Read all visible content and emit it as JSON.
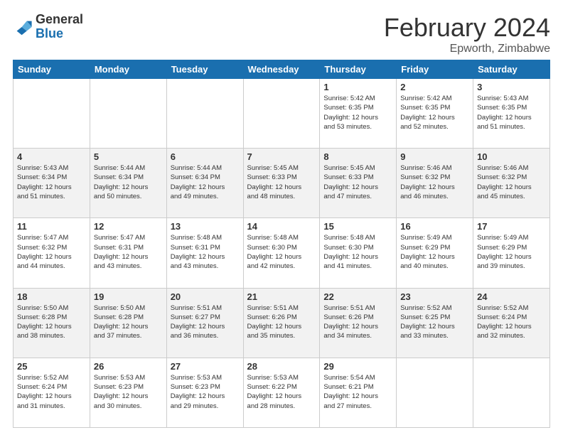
{
  "header": {
    "logo_general": "General",
    "logo_blue": "Blue",
    "title": "February 2024",
    "subtitle": "Epworth, Zimbabwe"
  },
  "weekdays": [
    "Sunday",
    "Monday",
    "Tuesday",
    "Wednesday",
    "Thursday",
    "Friday",
    "Saturday"
  ],
  "weeks": [
    [
      {
        "day": "",
        "info": ""
      },
      {
        "day": "",
        "info": ""
      },
      {
        "day": "",
        "info": ""
      },
      {
        "day": "",
        "info": ""
      },
      {
        "day": "1",
        "info": "Sunrise: 5:42 AM\nSunset: 6:35 PM\nDaylight: 12 hours\nand 53 minutes."
      },
      {
        "day": "2",
        "info": "Sunrise: 5:42 AM\nSunset: 6:35 PM\nDaylight: 12 hours\nand 52 minutes."
      },
      {
        "day": "3",
        "info": "Sunrise: 5:43 AM\nSunset: 6:35 PM\nDaylight: 12 hours\nand 51 minutes."
      }
    ],
    [
      {
        "day": "4",
        "info": "Sunrise: 5:43 AM\nSunset: 6:34 PM\nDaylight: 12 hours\nand 51 minutes."
      },
      {
        "day": "5",
        "info": "Sunrise: 5:44 AM\nSunset: 6:34 PM\nDaylight: 12 hours\nand 50 minutes."
      },
      {
        "day": "6",
        "info": "Sunrise: 5:44 AM\nSunset: 6:34 PM\nDaylight: 12 hours\nand 49 minutes."
      },
      {
        "day": "7",
        "info": "Sunrise: 5:45 AM\nSunset: 6:33 PM\nDaylight: 12 hours\nand 48 minutes."
      },
      {
        "day": "8",
        "info": "Sunrise: 5:45 AM\nSunset: 6:33 PM\nDaylight: 12 hours\nand 47 minutes."
      },
      {
        "day": "9",
        "info": "Sunrise: 5:46 AM\nSunset: 6:32 PM\nDaylight: 12 hours\nand 46 minutes."
      },
      {
        "day": "10",
        "info": "Sunrise: 5:46 AM\nSunset: 6:32 PM\nDaylight: 12 hours\nand 45 minutes."
      }
    ],
    [
      {
        "day": "11",
        "info": "Sunrise: 5:47 AM\nSunset: 6:32 PM\nDaylight: 12 hours\nand 44 minutes."
      },
      {
        "day": "12",
        "info": "Sunrise: 5:47 AM\nSunset: 6:31 PM\nDaylight: 12 hours\nand 43 minutes."
      },
      {
        "day": "13",
        "info": "Sunrise: 5:48 AM\nSunset: 6:31 PM\nDaylight: 12 hours\nand 43 minutes."
      },
      {
        "day": "14",
        "info": "Sunrise: 5:48 AM\nSunset: 6:30 PM\nDaylight: 12 hours\nand 42 minutes."
      },
      {
        "day": "15",
        "info": "Sunrise: 5:48 AM\nSunset: 6:30 PM\nDaylight: 12 hours\nand 41 minutes."
      },
      {
        "day": "16",
        "info": "Sunrise: 5:49 AM\nSunset: 6:29 PM\nDaylight: 12 hours\nand 40 minutes."
      },
      {
        "day": "17",
        "info": "Sunrise: 5:49 AM\nSunset: 6:29 PM\nDaylight: 12 hours\nand 39 minutes."
      }
    ],
    [
      {
        "day": "18",
        "info": "Sunrise: 5:50 AM\nSunset: 6:28 PM\nDaylight: 12 hours\nand 38 minutes."
      },
      {
        "day": "19",
        "info": "Sunrise: 5:50 AM\nSunset: 6:28 PM\nDaylight: 12 hours\nand 37 minutes."
      },
      {
        "day": "20",
        "info": "Sunrise: 5:51 AM\nSunset: 6:27 PM\nDaylight: 12 hours\nand 36 minutes."
      },
      {
        "day": "21",
        "info": "Sunrise: 5:51 AM\nSunset: 6:26 PM\nDaylight: 12 hours\nand 35 minutes."
      },
      {
        "day": "22",
        "info": "Sunrise: 5:51 AM\nSunset: 6:26 PM\nDaylight: 12 hours\nand 34 minutes."
      },
      {
        "day": "23",
        "info": "Sunrise: 5:52 AM\nSunset: 6:25 PM\nDaylight: 12 hours\nand 33 minutes."
      },
      {
        "day": "24",
        "info": "Sunrise: 5:52 AM\nSunset: 6:24 PM\nDaylight: 12 hours\nand 32 minutes."
      }
    ],
    [
      {
        "day": "25",
        "info": "Sunrise: 5:52 AM\nSunset: 6:24 PM\nDaylight: 12 hours\nand 31 minutes."
      },
      {
        "day": "26",
        "info": "Sunrise: 5:53 AM\nSunset: 6:23 PM\nDaylight: 12 hours\nand 30 minutes."
      },
      {
        "day": "27",
        "info": "Sunrise: 5:53 AM\nSunset: 6:23 PM\nDaylight: 12 hours\nand 29 minutes."
      },
      {
        "day": "28",
        "info": "Sunrise: 5:53 AM\nSunset: 6:22 PM\nDaylight: 12 hours\nand 28 minutes."
      },
      {
        "day": "29",
        "info": "Sunrise: 5:54 AM\nSunset: 6:21 PM\nDaylight: 12 hours\nand 27 minutes."
      },
      {
        "day": "",
        "info": ""
      },
      {
        "day": "",
        "info": ""
      }
    ]
  ]
}
